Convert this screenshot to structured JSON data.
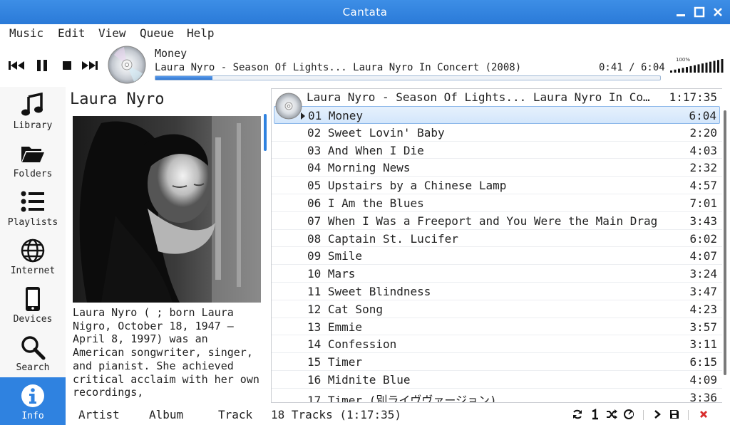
{
  "window": {
    "title": "Cantata"
  },
  "menu": [
    "Music",
    "Edit",
    "View",
    "Queue",
    "Help"
  ],
  "now_playing": {
    "title": "Money",
    "subtitle": "Laura Nyro - Season Of Lights... Laura Nyro In Concert (2008)",
    "time": "0:41 / 6:04",
    "progress": 0.113,
    "volume_label": "100%",
    "volume": 1.0
  },
  "sidebar": [
    {
      "label": "Library",
      "icon": "music-note-icon"
    },
    {
      "label": "Folders",
      "icon": "folder-icon"
    },
    {
      "label": "Playlists",
      "icon": "playlist-icon"
    },
    {
      "label": "Internet",
      "icon": "globe-icon"
    },
    {
      "label": "Devices",
      "icon": "phone-icon"
    },
    {
      "label": "Search",
      "icon": "search-icon"
    },
    {
      "label": "Info",
      "icon": "info-icon",
      "active": true
    }
  ],
  "info": {
    "artist": "Laura Nyro",
    "bio": "Laura Nyro ( ; born Laura Nigro, October 18, 1947 – April 8, 1997) was an American songwriter, singer, and pianist. She achieved critical acclaim with her own recordings,",
    "tabs": [
      "Artist",
      "Album",
      "Track"
    ]
  },
  "playlist": {
    "header": "Laura Nyro - Season Of Lights... Laura Nyro In Co…",
    "header_time": "1:17:35",
    "tracks": [
      {
        "title": "01 Money",
        "duration": "6:04",
        "current": true
      },
      {
        "title": "02 Sweet Lovin' Baby",
        "duration": "2:20"
      },
      {
        "title": "03 And When I Die",
        "duration": "4:03"
      },
      {
        "title": "04 Morning News",
        "duration": "2:32"
      },
      {
        "title": "05 Upstairs by a Chinese Lamp",
        "duration": "4:57"
      },
      {
        "title": "06 I Am the Blues",
        "duration": "7:01"
      },
      {
        "title": "07 When I Was a Freeport and You Were the Main Drag",
        "duration": "3:43"
      },
      {
        "title": "08 Captain St. Lucifer",
        "duration": "6:02"
      },
      {
        "title": "09 Smile",
        "duration": "4:07"
      },
      {
        "title": "10 Mars",
        "duration": "3:24"
      },
      {
        "title": "11 Sweet Blindness",
        "duration": "3:47"
      },
      {
        "title": "12 Cat Song",
        "duration": "4:23"
      },
      {
        "title": "13 Emmie",
        "duration": "3:57"
      },
      {
        "title": "14 Confession",
        "duration": "3:11"
      },
      {
        "title": "15 Timer",
        "duration": "6:15"
      },
      {
        "title": "16 Midnite Blue",
        "duration": "4:09"
      },
      {
        "title": "17 Timer (別ライヴヴァージョン)",
        "duration": "3:36"
      }
    ],
    "status": "18 Tracks (1:17:35)"
  },
  "colors": {
    "accent": "#2f82e0",
    "titlebar": "#3589e2"
  }
}
